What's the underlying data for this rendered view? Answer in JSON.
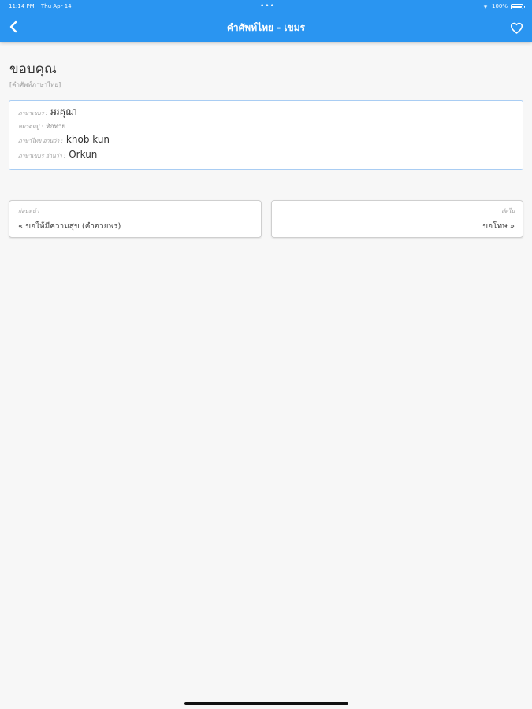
{
  "status_bar": {
    "time": "11:14 PM",
    "date": "Thu Apr 14",
    "dots": "•••",
    "battery": "100%"
  },
  "nav_bar": {
    "title": "คำศัพท์ไทย - เขมร",
    "back_icon": "chevron-left-icon",
    "favorite_icon": "heart-outline-icon",
    "background_color": "#2a95f1"
  },
  "word": {
    "title": "ขอบคุณ",
    "subtitle": "[คำศัพท์ภาษาไทย]"
  },
  "details": {
    "khmer_label": "ภาษาเขมร :",
    "khmer_value": "អរគុណ",
    "category_label": "หมวดหมู่ :",
    "category_value": "ทักทาย",
    "thai_reading_label": "ภาษาไทย อ่านว่า :",
    "thai_reading_value": "khob kun",
    "khmer_reading_label": "ภาษาเขมร อ่านว่า :",
    "khmer_reading_value": "Orkun"
  },
  "navigation": {
    "previous_caption": "ก่อนหน้า",
    "previous_value": "« ขอให้มีความสุข (คำอวยพร)",
    "next_caption": "ถัดไป",
    "next_value": "ขอโทษ »"
  }
}
